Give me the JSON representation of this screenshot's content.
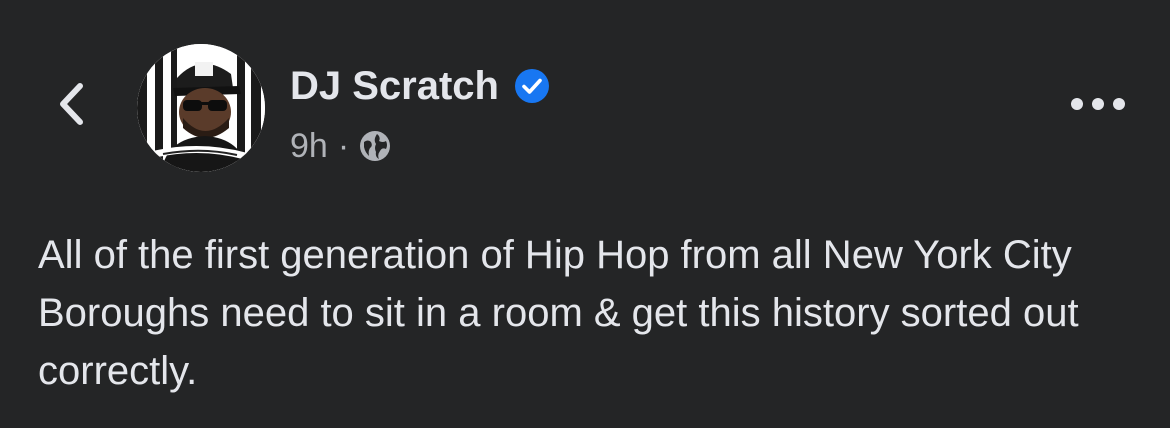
{
  "header": {
    "author_name": "DJ Scratch",
    "verified": true,
    "time_ago": "9h",
    "separator": "·",
    "audience_icon": "globe-icon"
  },
  "post": {
    "text": "All of the first generation of Hip Hop from all New York City Boroughs need to sit in a room & get this history sorted out correctly."
  },
  "icons": {
    "back": "chevron-left-icon",
    "more": "more-horizontal-icon",
    "verified": "verified-badge-icon"
  },
  "colors": {
    "background": "#242526",
    "primary_text": "#e4e6eb",
    "secondary_text": "#b0b3b8",
    "verified_blue": "#1877f2"
  }
}
